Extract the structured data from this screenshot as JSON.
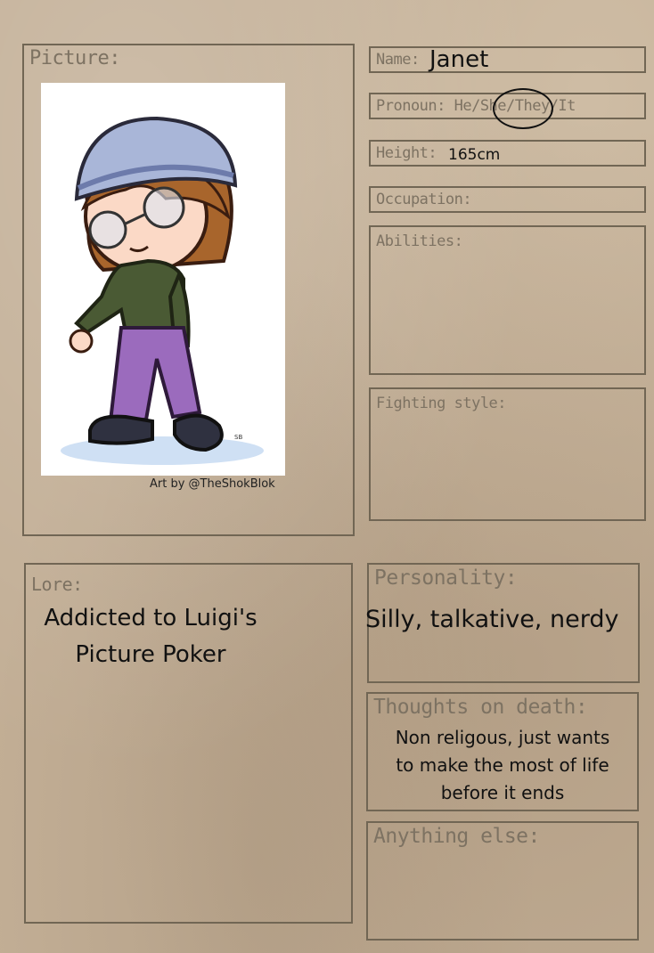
{
  "picture": {
    "label": "Picture:",
    "credit": "Art by @TheShokBlok"
  },
  "name": {
    "label": "Name:",
    "value": "Janet"
  },
  "pronoun": {
    "label": "Pronoun: He/She/They/It",
    "circled": "She"
  },
  "height": {
    "label": "Height:",
    "value": "165cm"
  },
  "occupation": {
    "label": "Occupation:",
    "value": ""
  },
  "abilities": {
    "label": "Abilities:",
    "value": ""
  },
  "fighting_style": {
    "label": "Fighting style:",
    "value": ""
  },
  "lore": {
    "label": "Lore:",
    "value": "Addicted to Luigi's Picture Poker"
  },
  "personality": {
    "label": "Personality:",
    "value": "Silly, talkative, nerdy"
  },
  "thoughts_on_death": {
    "label": "Thoughts on death:",
    "value": "Non religous, just wants to make the most of life before it ends"
  },
  "anything_else": {
    "label": "Anything else:",
    "value": ""
  },
  "colors": {
    "paper": "#c2ae95",
    "border": "#716654",
    "label": "#7d7262",
    "ink": "#111111"
  }
}
